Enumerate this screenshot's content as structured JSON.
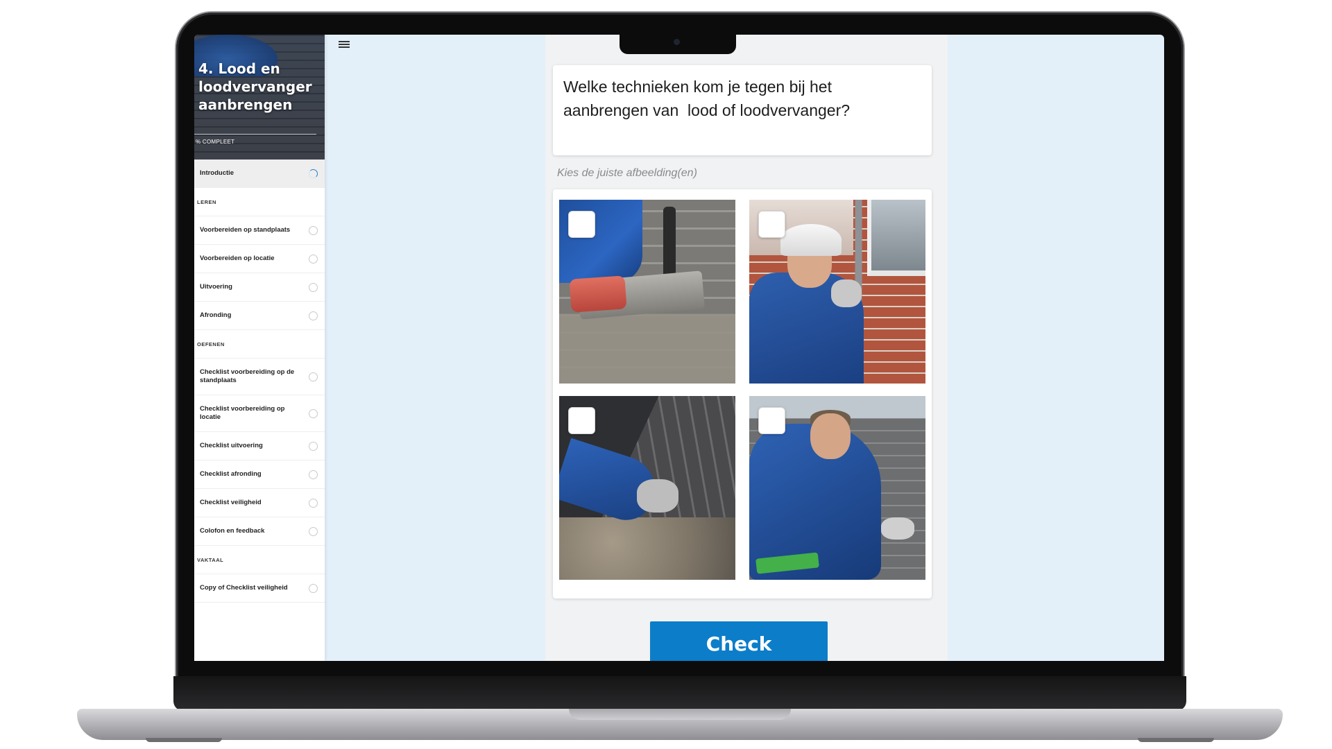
{
  "sidebar": {
    "course_title": "4. Lood en loodvervanger aanbrengen",
    "progress_label": "% COMPLEET",
    "items": [
      {
        "type": "item",
        "label": "Introductie",
        "status": "in-progress",
        "active": true
      },
      {
        "type": "section",
        "label": "LEREN"
      },
      {
        "type": "item",
        "label": "Voorbereiden op standplaats",
        "status": "not-started"
      },
      {
        "type": "item",
        "label": "Voorbereiden op locatie",
        "status": "not-started"
      },
      {
        "type": "item",
        "label": "Uitvoering",
        "status": "not-started"
      },
      {
        "type": "item",
        "label": "Afronding",
        "status": "not-started"
      },
      {
        "type": "section",
        "label": "OEFENEN"
      },
      {
        "type": "item",
        "label": "Checklist voorbereiding op de standplaats",
        "status": "not-started"
      },
      {
        "type": "item",
        "label": "Checklist voorbereiding op locatie",
        "status": "not-started"
      },
      {
        "type": "item",
        "label": "Checklist uitvoering",
        "status": "not-started"
      },
      {
        "type": "item",
        "label": "Checklist afronding",
        "status": "not-started"
      },
      {
        "type": "item",
        "label": "Checklist veiligheid",
        "status": "not-started"
      },
      {
        "type": "item",
        "label": "Colofon en feedback",
        "status": "not-started"
      },
      {
        "type": "section",
        "label": "VAKTAAL"
      },
      {
        "type": "item",
        "label": "Copy of Checklist veiligheid",
        "status": "not-started"
      }
    ]
  },
  "header": {
    "menu_icon": "hamburger-icon"
  },
  "quiz": {
    "question": "Welke technieken kom je tegen bij het\naanbrengen van  lood of loodvervanger?",
    "instruction": "Kies de juiste afbeelding(en)",
    "options": [
      {
        "id": "1",
        "checked": false
      },
      {
        "id": "2",
        "checked": false
      },
      {
        "id": "3",
        "checked": false
      },
      {
        "id": "4",
        "checked": false
      }
    ],
    "check_label": "Check"
  },
  "colors": {
    "accent": "#0c7dc9",
    "page_bg": "#e4f0f9",
    "progress": "#1d7fd0"
  }
}
